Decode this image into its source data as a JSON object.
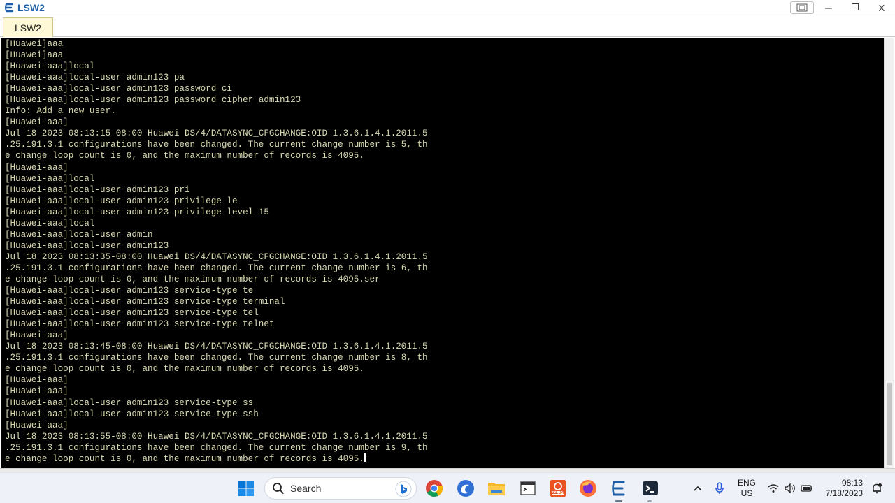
{
  "window": {
    "title": "LSW2",
    "controls": [
      "restore-down",
      "minimize",
      "maximize",
      "close"
    ],
    "minimize_glyph": "—",
    "maximize_glyph": "❐",
    "close_glyph": "X"
  },
  "tabs": [
    {
      "label": "LSW2",
      "active": true
    }
  ],
  "terminal": {
    "lines": [
      "[Huawei]aaa",
      "[Huawei]aaa",
      "[Huawei-aaa]local",
      "[Huawei-aaa]local-user admin123 pa",
      "[Huawei-aaa]local-user admin123 password ci",
      "[Huawei-aaa]local-user admin123 password cipher admin123",
      "Info: Add a new user.",
      "[Huawei-aaa]",
      "Jul 18 2023 08:13:15-08:00 Huawei DS/4/DATASYNC_CFGCHANGE:OID 1.3.6.1.4.1.2011.5",
      ".25.191.3.1 configurations have been changed. The current change number is 5, th",
      "e change loop count is 0, and the maximum number of records is 4095.",
      "[Huawei-aaa]",
      "[Huawei-aaa]local",
      "[Huawei-aaa]local-user admin123 pri",
      "[Huawei-aaa]local-user admin123 privilege le",
      "[Huawei-aaa]local-user admin123 privilege level 15",
      "[Huawei-aaa]local",
      "[Huawei-aaa]local-user admin",
      "[Huawei-aaa]local-user admin123",
      "Jul 18 2023 08:13:35-08:00 Huawei DS/4/DATASYNC_CFGCHANGE:OID 1.3.6.1.4.1.2011.5",
      ".25.191.3.1 configurations have been changed. The current change number is 6, th",
      "e change loop count is 0, and the maximum number of records is 4095.ser",
      "[Huawei-aaa]local-user admin123 service-type te",
      "[Huawei-aaa]local-user admin123 service-type terminal",
      "[Huawei-aaa]local-user admin123 service-type tel",
      "[Huawei-aaa]local-user admin123 service-type telnet",
      "[Huawei-aaa]",
      "Jul 18 2023 08:13:45-08:00 Huawei DS/4/DATASYNC_CFGCHANGE:OID 1.3.6.1.4.1.2011.5",
      ".25.191.3.1 configurations have been changed. The current change number is 8, th",
      "e change loop count is 0, and the maximum number of records is 4095.",
      "[Huawei-aaa]",
      "[Huawei-aaa]",
      "[Huawei-aaa]local-user admin123 service-type ss",
      "[Huawei-aaa]local-user admin123 service-type ssh",
      "[Huawei-aaa]",
      "Jul 18 2023 08:13:55-08:00 Huawei DS/4/DATASYNC_CFGCHANGE:OID 1.3.6.1.4.1.2011.5",
      ".25.191.3.1 configurations have been changed. The current change number is 9, th",
      "e change loop count is 0, and the maximum number of records is 4095."
    ],
    "text_color": "#d9d9b0",
    "background": "#000000"
  },
  "taskbar": {
    "search_label": "Search",
    "apps": [
      "start-icon",
      "search-icon",
      "chrome-icon",
      "browser-icon",
      "file-explorer-icon",
      "terminal-app-icon",
      "ubuntu-icon",
      "firefox-icon",
      "ensp-icon",
      "powershell-icon"
    ],
    "ubuntu_badge": "22.04",
    "tray": {
      "language_line1": "ENG",
      "language_line2": "US",
      "time": "08:13",
      "date": "7/18/2023"
    }
  }
}
